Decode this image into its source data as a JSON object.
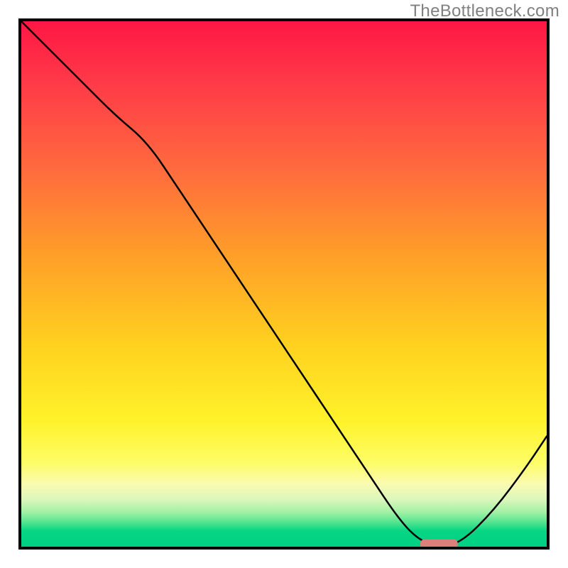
{
  "attribution": "TheBottleneck.com",
  "chart_data": {
    "type": "line",
    "title": "",
    "xlabel": "",
    "ylabel": "",
    "xlim": [
      0,
      100
    ],
    "ylim": [
      0,
      100
    ],
    "grid": false,
    "legend": false,
    "series": [
      {
        "name": "bottleneck-curve",
        "x": [
          0,
          6,
          12,
          18,
          24,
          30,
          36,
          42,
          48,
          54,
          60,
          66,
          72,
          76,
          80,
          84,
          90,
          96,
          100
        ],
        "y": [
          100,
          94,
          88,
          82,
          77,
          68,
          59,
          50,
          41,
          32,
          23,
          14,
          5,
          1,
          0,
          1,
          7,
          15,
          21
        ]
      }
    ],
    "marker": {
      "name": "optimal-range",
      "x_start": 76,
      "x_end": 83,
      "y": 0.5,
      "color": "#dd7f7a"
    },
    "background_gradient": {
      "top_color": "#ff1744",
      "mid_color": "#ffd21f",
      "bottom_color": "#00d084"
    }
  }
}
